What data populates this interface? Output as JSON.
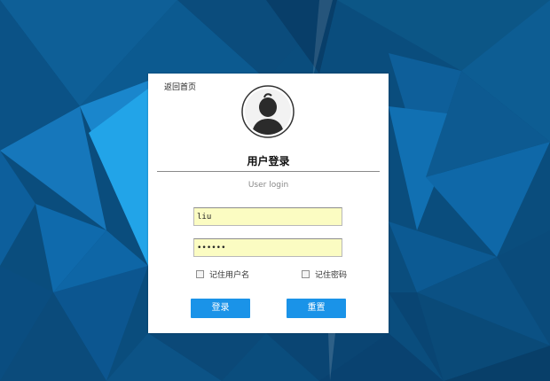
{
  "background": {
    "colors": [
      "#0a4f80",
      "#0e6aa8",
      "#1a8ad0",
      "#0b3d66",
      "#062f52",
      "#1f9de0",
      "#084470"
    ]
  },
  "login_panel": {
    "home_link": "返回首页",
    "avatar_icon": "user-avatar-icon",
    "title": "用户登录",
    "subtitle": "User login",
    "username": {
      "value": "liu",
      "placeholder": ""
    },
    "password": {
      "value": "123456",
      "placeholder": ""
    },
    "remember_username_label": "记住用户名",
    "remember_password_label": "记住密码",
    "login_button": "登录",
    "reset_button": "重置",
    "accent_color": "#1a93e8",
    "input_bg_color": "#fbfcc2"
  }
}
